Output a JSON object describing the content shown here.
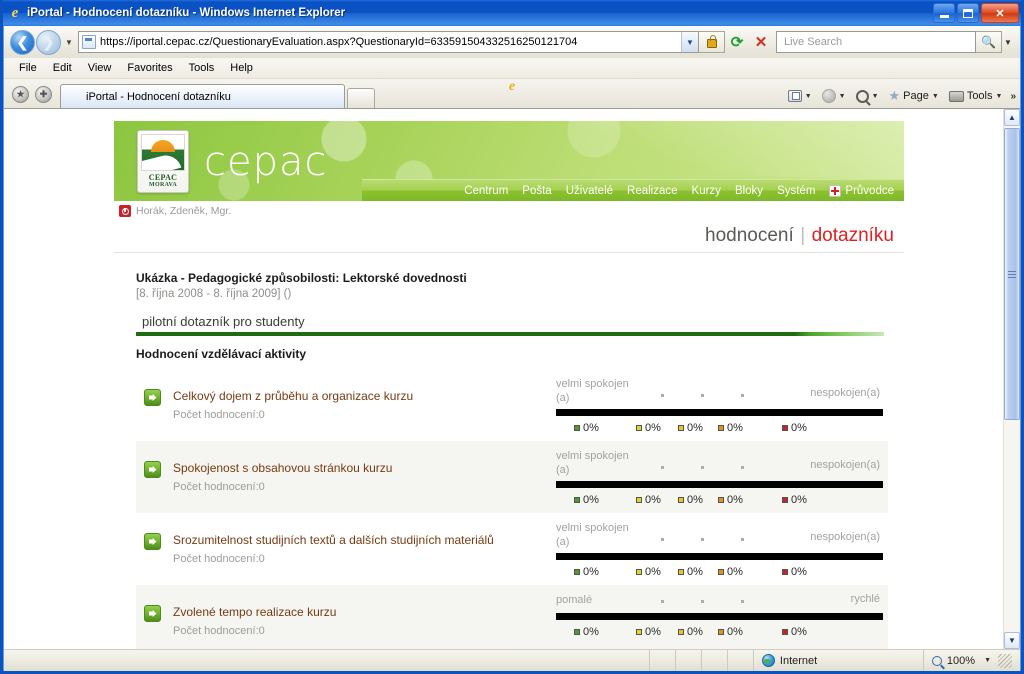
{
  "browser": {
    "window_title": "iPortal - Hodnocení dotazníku - Windows Internet Explorer",
    "minimize_label": "Minimize",
    "maximize_label": "Maximize",
    "close_label": "Close",
    "back_label": "Back",
    "forward_label": "Forward",
    "url": "https://iportal.cepac.cz/QuestionaryEvaluation.aspx?QuestionaryId=633591504332516250121704",
    "refresh_label": "Refresh",
    "stop_label": "Stop",
    "search_placeholder": "Live Search",
    "search_value": "",
    "menu": [
      "File",
      "Edit",
      "View",
      "Favorites",
      "Tools",
      "Help"
    ],
    "tab_title": "iPortal - Hodnocení dotazníku",
    "new_tab_label": "",
    "command_bar": {
      "page_label": "Page",
      "tools_label": "Tools",
      "overflow_label": "»"
    },
    "status": {
      "message": "",
      "zone": "Internet",
      "zoom": "100%"
    }
  },
  "site": {
    "brand": "cepac",
    "logo_line1": "CEPAC",
    "logo_line2": "MORAVA",
    "nav": [
      {
        "label": "Centrum"
      },
      {
        "label": "Pošta"
      },
      {
        "label": "Uživatelé"
      },
      {
        "label": "Realizace"
      },
      {
        "label": "Kurzy"
      },
      {
        "label": "Bloky"
      },
      {
        "label": "Systém"
      },
      {
        "label": "Průvodce"
      }
    ],
    "user": "Horák, Zdeněk, Mgr.",
    "breadcrumb": {
      "first": "hodnocení",
      "separator": "|",
      "second": "dotazníku"
    },
    "course": {
      "title": "Ukázka - Pedagogické způsobilosti:  Lektorské dovednosti",
      "dates": "[8. října 2008 - 8. října 2009]  ()"
    },
    "questionnaire_title": "pilotní dotazník pro studenty",
    "section_title": "Hodnocení vzdělávací aktivity",
    "count_prefix": "Počet hodnocení:",
    "questions": [
      {
        "text": "Celkový dojem z průběhu a organizace kurzu",
        "count": "Počet hodnocení:0",
        "left_label": "velmi spokojen (a)",
        "right_label": "nespokojen(a)",
        "values": [
          "0%",
          "0%",
          "0%",
          "0%",
          "0%"
        ]
      },
      {
        "text": "Spokojenost s obsahovou stránkou kurzu",
        "count": "Počet hodnocení:0",
        "left_label": "velmi spokojen (a)",
        "right_label": "nespokojen(a)",
        "values": [
          "0%",
          "0%",
          "0%",
          "0%",
          "0%"
        ]
      },
      {
        "text": "Srozumitelnost studijních textů a dalších studijních materiálů",
        "count": "Počet hodnocení:0",
        "left_label": "velmi spokojen (a)",
        "right_label": "nespokojen(a)",
        "values": [
          "0%",
          "0%",
          "0%",
          "0%",
          "0%"
        ]
      },
      {
        "text": "Zvolené tempo realizace kurzu",
        "count": "Počet hodnocení:0",
        "left_label": "pomalé",
        "right_label": "rychlé",
        "values": [
          "0%",
          "0%",
          "0%",
          "0%",
          "0%"
        ]
      }
    ],
    "scale_colors": [
      "#4e9a2a",
      "#e8d41e",
      "#e8c41e",
      "#e8901a",
      "#d01f1f"
    ]
  }
}
